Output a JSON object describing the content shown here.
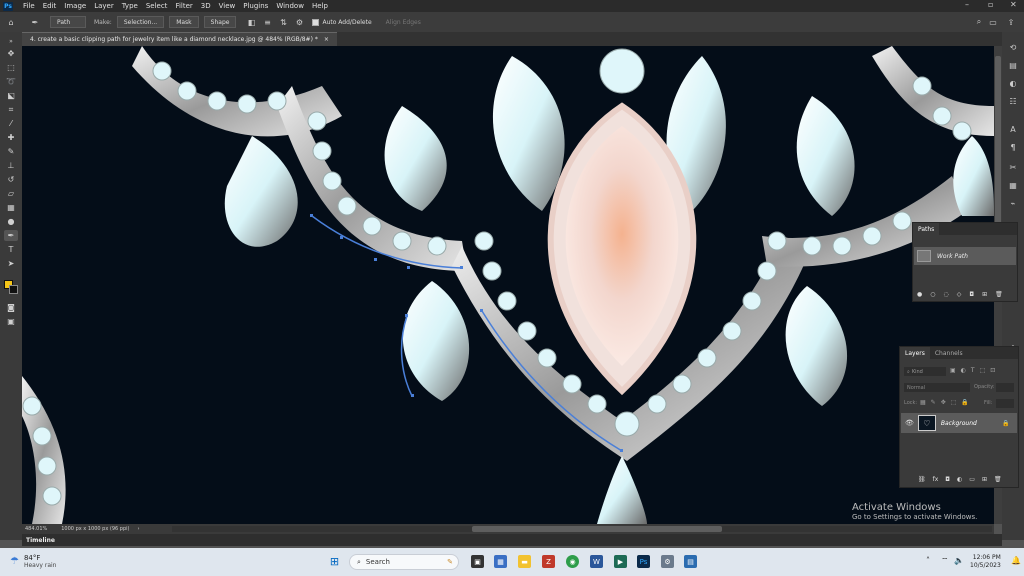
{
  "app": {
    "logo": "Ps",
    "menu": [
      "File",
      "Edit",
      "Image",
      "Layer",
      "Type",
      "Select",
      "Filter",
      "3D",
      "View",
      "Plugins",
      "Window",
      "Help"
    ]
  },
  "options": {
    "mode_value": "Path",
    "make_label": "Make:",
    "selection_button": "Selection...",
    "mask_button": "Mask",
    "shape_button": "Shape",
    "auto_add_delete_label": "Auto Add/Delete",
    "align_edges_label": "Align Edges"
  },
  "document": {
    "tab_title": "4. create a basic clipping path for jewelry item like a diamond necklace.jpg @ 484% (RGB/8#) *",
    "close_glyph": "×"
  },
  "status": {
    "zoom": "484.01%",
    "doc_size": "1000 px x 1000 px (96 ppi)"
  },
  "paths_panel": {
    "tab": "Paths",
    "items": [
      {
        "name": "Work Path"
      }
    ]
  },
  "layers_panel": {
    "tabs": [
      "Layers",
      "Channels"
    ],
    "kind_filter": "Kind",
    "blend_mode": "Normal",
    "opacity_label": "Opacity:",
    "lock_label": "Lock:",
    "fill_label": "Fill:",
    "layers": [
      {
        "name": "Background",
        "visible": true,
        "locked": true
      }
    ]
  },
  "timeline": {
    "label": "Timeline"
  },
  "watermark": {
    "title": "Activate Windows",
    "subtitle": "Go to Settings to activate Windows."
  },
  "taskbar": {
    "weather_temp": "84°F",
    "weather_desc": "Heavy rain",
    "search_placeholder": "Search",
    "time": "12:06 PM",
    "date": "10/5/2023"
  },
  "colors": {
    "foreground": "#f5c518",
    "background": "#111111",
    "canvas": "#040d18",
    "path": "#4a7fd8"
  }
}
